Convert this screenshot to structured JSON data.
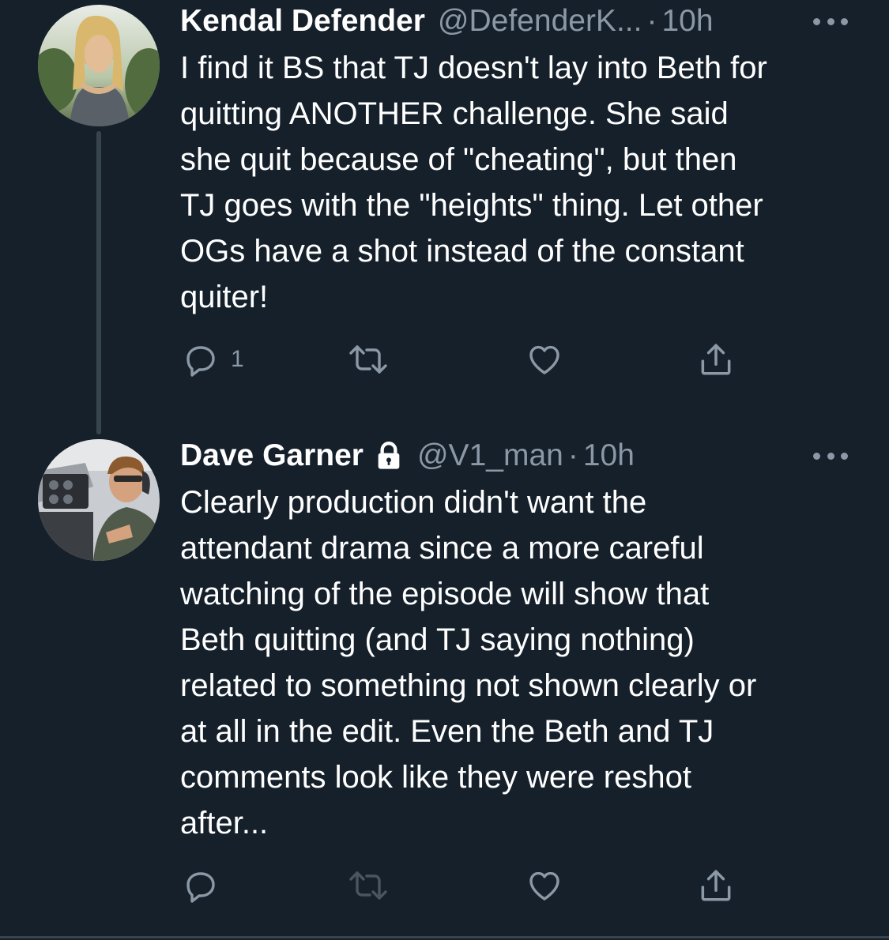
{
  "tweets": [
    {
      "author_name": "Kendal Defender",
      "handle": "@DefenderK...",
      "separator": "·",
      "time": "10h",
      "protected": false,
      "text": "I find it BS that TJ doesn't lay into Beth for\nquitting ANOTHER challenge. She said\nshe quit because of \"cheating\", but then\nTJ goes with the \"heights\" thing. Let other\nOGs have a shot instead of the constant\nquiter!",
      "reply_count": "1",
      "avatar_icon": "avatar-woman-forest"
    },
    {
      "author_name": "Dave Garner",
      "handle": "@V1_man",
      "separator": "·",
      "time": "10h",
      "protected": true,
      "text": "Clearly production didn't want the\nattendant drama since a more careful\nwatching of the episode will show that\nBeth quitting (and TJ saying nothing)\nrelated to something not shown clearly or\nat all in the edit. Even the Beth and TJ\ncomments look like they were reshot\nafter...",
      "reply_count": "",
      "avatar_icon": "avatar-pilot-cockpit"
    }
  ],
  "icons": {
    "reply": "reply-icon",
    "retweet": "retweet-icon",
    "like": "like-icon",
    "share": "share-icon",
    "more": "more-options-icon",
    "lock": "lock-icon"
  },
  "colors": {
    "background": "#15202b",
    "secondary_text": "#8b98a5",
    "primary_text": "#ffffff",
    "divider": "#38444d"
  }
}
